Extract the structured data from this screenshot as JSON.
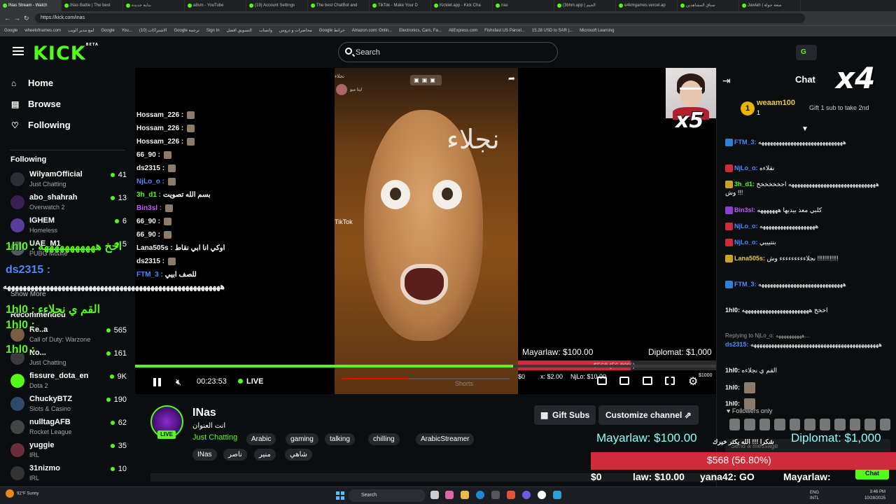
{
  "browser": {
    "tabs": [
      "INas Stream - Watch",
      "INas Battle | The best",
      "بداية جديدة ",
      "a8sm - YouTube",
      "(19) Account Settings",
      "The best ChatBot and",
      "TikTok - Make Your D",
      "Kicklet.app - Kick Cha",
      "nas",
      "(3bhm.app | الجيم",
      "e4kmgames.vercel.ap",
      "سباق المشاهدين",
      "Jawlah | متعة جولة"
    ],
    "url": "https://kick.com/inas",
    "bookmarks": [
      "Google",
      "wheelofnames.com",
      "لمع مدير الويب",
      "Google",
      "You...",
      "(10) الاشتراكات",
      "Google ترجمة",
      "Sign In",
      "التسويق افضل",
      "واتساب",
      "محاضرات و دروس",
      "Google خرائط",
      "Amazon.com: Onlin...",
      "Electronics, Cars, Fa...",
      "AliExpress.com",
      "Fishsfast US Parcel...",
      "15.28 USD to SAR |...",
      "Microsoft Learning"
    ]
  },
  "header": {
    "logo": "KICK",
    "logo_sup": "BETA",
    "search_placeholder": "Search",
    "go_label": "G"
  },
  "sidebar": {
    "nav": [
      {
        "label": "Home",
        "icon": "home-icon",
        "glyph": "⌂"
      },
      {
        "label": "Browse",
        "icon": "browse-icon",
        "glyph": "▤"
      },
      {
        "label": "Following",
        "icon": "heart-icon",
        "glyph": "♡"
      }
    ],
    "following_heading": "Following",
    "following": [
      {
        "name": "WilyamOfficial",
        "category": "Just Chatting",
        "viewers": "41",
        "color": "#2b2f33"
      },
      {
        "name": "abo_shahrah",
        "category": "Overwatch 2",
        "viewers": "13",
        "color": "#3a1f55"
      },
      {
        "name": "IGHEM",
        "category": "Homeless",
        "viewers": "6",
        "color": "#5a3d9a"
      },
      {
        "name": "UAE_M1",
        "category": "PUBG Mobile",
        "viewers": "5",
        "color": "#505a66"
      }
    ],
    "show_more": "Show More",
    "recommended_heading": "Recommended",
    "recommended": [
      {
        "name": "Re..a",
        "category": "Call of Duty: Warzone",
        "viewers": "565",
        "color": "#7a5b46"
      },
      {
        "name": "No...",
        "category": "Just Chatting",
        "viewers": "161",
        "color": "#3b3b3b"
      },
      {
        "name": "fissure_dota_en",
        "category": "Dota 2",
        "viewers": "9K",
        "color": "#53fc18"
      },
      {
        "name": "ChuckyBTZ",
        "category": "Slots & Casino",
        "viewers": "190",
        "color": "#2d4a6a"
      },
      {
        "name": "nulltagAFB",
        "category": "Rocket League",
        "viewers": "62",
        "color": "#444"
      },
      {
        "name": "yuggie",
        "category": "IRL",
        "viewers": "35",
        "color": "#6a2d3a"
      },
      {
        "name": "31nizmo",
        "category": "IRL",
        "viewers": "10",
        "color": "#333"
      }
    ]
  },
  "player": {
    "video_title": "نجلاء",
    "video_top": "نجلاء",
    "video_profile": "ليتا ميو",
    "tiktok": "TikTok",
    "shorts_label": "Shorts",
    "cam_multiplier": "x5",
    "overlay_chat": [
      {
        "user": "Hossam_226 :",
        "msg": "",
        "color": "#f2f2f2"
      },
      {
        "user": "Hossam_226 :",
        "msg": "",
        "color": "#f2f2f2"
      },
      {
        "user": "Hossam_226 :",
        "msg": "",
        "color": "#f2f2f2"
      },
      {
        "user": "66_90 :",
        "msg": "",
        "color": "#f2f2f2"
      },
      {
        "user": "ds2315 :",
        "msg": "",
        "color": "#f2f2f2"
      },
      {
        "user": "NjLo_o :",
        "msg": "",
        "color": "#4b8bff"
      },
      {
        "user": "3h_d1 :",
        "msg": "بسم الله تصويت",
        "color": "#53fc18"
      },
      {
        "user": "Bin3sl :",
        "msg": "",
        "color": "#c05cff"
      },
      {
        "user": "66_90 :",
        "msg": "",
        "color": "#f2f2f2"
      },
      {
        "user": "66_90 :",
        "msg": "",
        "color": "#f2f2f2"
      },
      {
        "user": "Lana505s :",
        "msg": "اوكي انا ابي نقاط",
        "color": "#f2f2f2"
      },
      {
        "user": "ds2315 :",
        "msg": "",
        "color": "#f2f2f2"
      },
      {
        "user": "FTM_3 :",
        "msg": "للصف ابيي",
        "color": "#4b8bff"
      }
    ],
    "goal_left": "Mayarlaw: $100.00",
    "goal_right": "Diplomat: $1,000",
    "goal_pct_text": "$568 (56.80%)",
    "goal_fraction": 0.568,
    "goal_row": {
      "start": "$0",
      "mid1": "x: $2.00",
      "mid2": "NjLo: $10.00",
      "end": "$1000"
    },
    "progress_fraction": 0.65,
    "timestamp": "00:23:53",
    "live_label": "LIVE"
  },
  "stream": {
    "channel": "INas",
    "title": "انت العنوان",
    "category": "Just Chatting",
    "live_badge": "LIVE",
    "tags": [
      "Arabic",
      "gaming",
      "talking",
      "chilling",
      "ArabicStreamer",
      "INas",
      "ناصر",
      "منير",
      "شاهي"
    ],
    "gift_subs": "Gift Subs",
    "customize": "Customize channel ⇗"
  },
  "chat": {
    "title": "Chat",
    "multiplier": "x4",
    "pinned_user": "weaam100",
    "pinned_count": "1",
    "pinned_text": "Gift 1 sub to take 2nd",
    "messages": [
      {
        "user": "FTM_3:",
        "text": "هههههههههههههههههههههههههههههه",
        "color": "#4b8bff",
        "badge": "#2d7fd9"
      },
      {
        "user": "NjLo_o:",
        "text": "نقلاءه",
        "color": "#4b8bff",
        "badge": "#d02b3a"
      },
      {
        "user": "3h_d1:",
        "text": "ههههههههههههههههههههههههههههههه احخخخخخخ وش !!!",
        "color": "#53fc18",
        "badge": "#c9a227"
      },
      {
        "user": "Bin3sl:",
        "text": "كلبي معذ بيديها هههههههه",
        "color": "#c05cff",
        "badge": "#8a3fd0"
      },
      {
        "user": "NjLo_o:",
        "text": "هههههههههههههههههههه",
        "color": "#4b8bff",
        "badge": "#d02b3a"
      },
      {
        "user": "NjLo_o:",
        "text": "بتتيييي",
        "color": "#4b8bff",
        "badge": "#d02b3a"
      },
      {
        "user": "Lana505s:",
        "text": "نجلاءءءءءءءءء وش !!!!!!!!!!!!",
        "color": "#e8c84a",
        "badge": "#c9a227"
      },
      {
        "user": "FTM_3:",
        "text": "هههههههههههههههههههههههههههههه",
        "color": "#4b8bff",
        "badge": "#2d7fd9"
      },
      {
        "user": "1hl0:",
        "text": "اخخخ هههههههههههههههههههههههه",
        "color": "#f2f2f2",
        "badge": ""
      },
      {
        "user": "ds2315:",
        "text": "ههههههههههههههههههههههههههههههههههههههههههههه",
        "color": "#4b8bff",
        "badge": "",
        "reply": "Replying to NjLo_o: ههههههههههه..."
      },
      {
        "user": "1hl0:",
        "text": "القم ي نجلاءه",
        "color": "#f2f2f2",
        "badge": ""
      },
      {
        "user": "1hl0:",
        "text": "",
        "color": "#f2f2f2",
        "badge": ""
      },
      {
        "user": "1hl0:",
        "text": "",
        "color": "#f2f2f2",
        "badge": ""
      }
    ],
    "followers_only": "♥ Followers only",
    "input_placeholder": "Send a message",
    "send_label": "Chat"
  },
  "big_overlay": {
    "goal_left": "Mayarlaw: $100.00",
    "goal_arabic": "شكرا !!! الله يكثر خيرك",
    "goal_right": "Diplomat: $1,000",
    "bar_text": "$568 (56.80%)",
    "bar_fraction": 0.568,
    "row": {
      "start": "$0",
      "mid1": "law: $10.00",
      "mid2": "yana42: GO",
      "mid3": "Mayarlaw:"
    },
    "lines": [
      {
        "text": "1hl0 :  اخخ هههههههههههه",
        "color": "#53fc18"
      },
      {
        "text": "ds2315 :",
        "color": "#4b8bff"
      },
      {
        "text": "ههههههههههههههههههههههههههههههههههههههههههههههههههههههههه",
        "color": "#ffffff"
      },
      {
        "text": "1hl0 :  القم ي نجلاءء",
        "color": "#53fc18"
      },
      {
        "text": "1hl0 :",
        "color": "#53fc18"
      },
      {
        "text": "1hl0 :",
        "color": "#53fc18"
      }
    ]
  },
  "taskbar": {
    "weather_temp": "92°F",
    "weather_desc": "Sunny",
    "search": "Search",
    "lang": "ENG\nINTL",
    "time": "3:46 PM",
    "date": "10/28/2025"
  }
}
